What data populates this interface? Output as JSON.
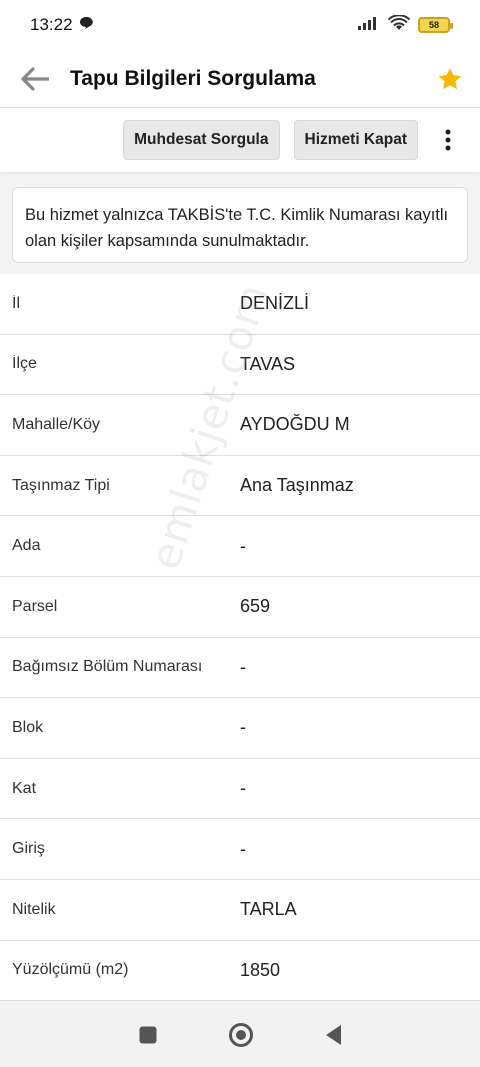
{
  "status": {
    "time": "13:22",
    "battery": "58"
  },
  "header": {
    "title": "Tapu Bilgileri Sorgulama"
  },
  "toolbar": {
    "muhdesat_label": "Muhdesat Sorgula",
    "close_label": "Hizmeti Kapat"
  },
  "notice": {
    "text": "Bu hizmet yalnızca TAKBİS'te T.C. Kimlik Numarası kayıtlı olan kişiler kapsamında sunulmaktadır."
  },
  "info": {
    "rows": [
      {
        "label": "İl",
        "value": "DENİZLİ"
      },
      {
        "label": "İlçe",
        "value": "TAVAS"
      },
      {
        "label": "Mahalle/Köy",
        "value": "AYDOĞDU M"
      },
      {
        "label": "Taşınmaz Tipi",
        "value": "Ana Taşınmaz"
      },
      {
        "label": "Ada",
        "value": "-"
      },
      {
        "label": "Parsel",
        "value": "659"
      },
      {
        "label": "Bağımsız Bölüm Numarası",
        "value": "-"
      },
      {
        "label": "Blok",
        "value": "-"
      },
      {
        "label": "Kat",
        "value": "-"
      },
      {
        "label": "Giriş",
        "value": "-"
      },
      {
        "label": "Nitelik",
        "value": "TARLA"
      },
      {
        "label": "Yüzölçümü (m2)",
        "value": "1850"
      }
    ]
  },
  "watermark": {
    "text": "emlakjet.com"
  },
  "colors": {
    "star": "#f5b800",
    "back_arrow": "#888888"
  }
}
